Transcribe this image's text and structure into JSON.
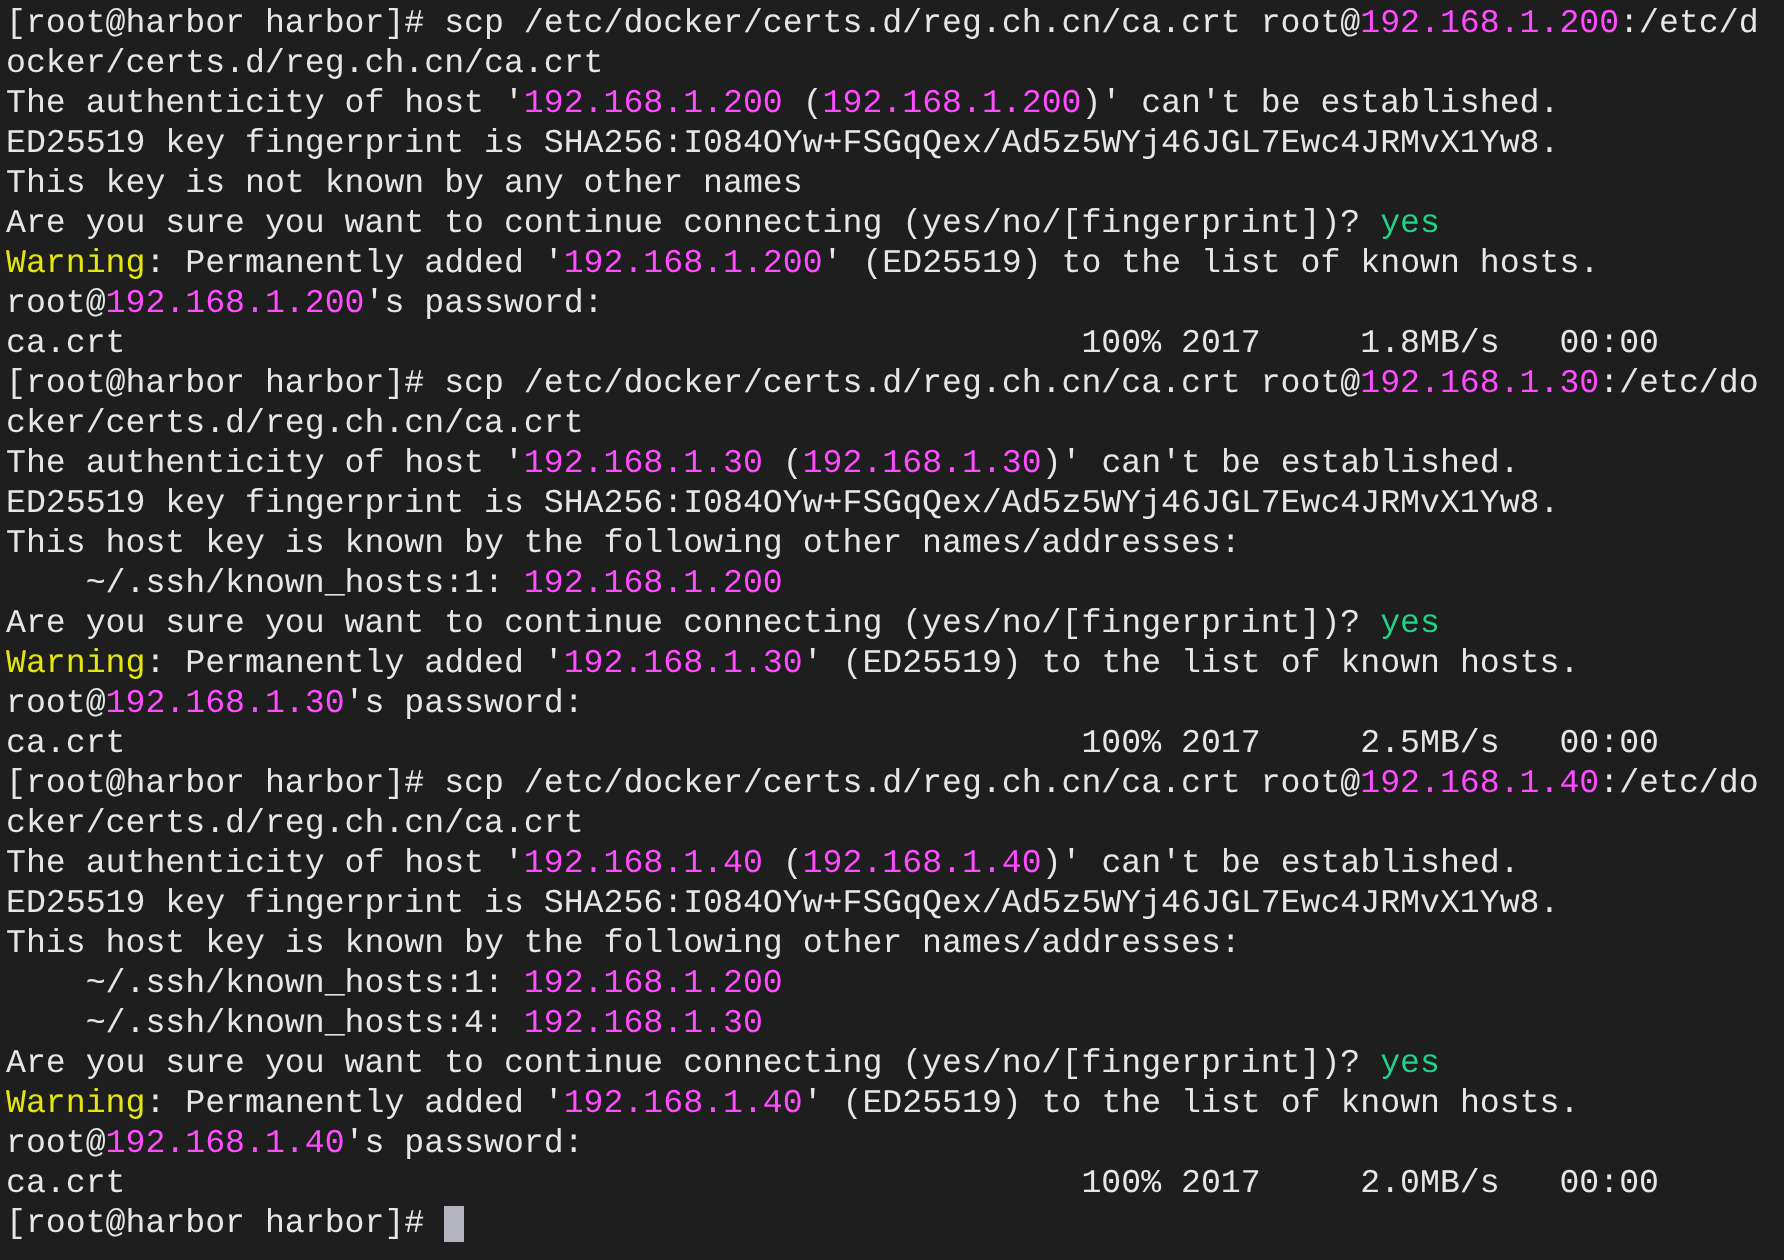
{
  "terminal": {
    "lines": [
      {
        "segments": [
          {
            "text": "[root@harbor harbor]# scp /etc/docker/certs.d/reg.ch.cn/ca.crt root@",
            "kind": "plain"
          },
          {
            "text": "192.168.1.200",
            "kind": "ip"
          },
          {
            "text": ":/etc/d",
            "kind": "plain"
          }
        ]
      },
      {
        "segments": [
          {
            "text": "ocker/certs.d/reg.ch.cn/ca.crt",
            "kind": "plain"
          }
        ]
      },
      {
        "segments": [
          {
            "text": "The authenticity of host '",
            "kind": "plain"
          },
          {
            "text": "192.168.1.200",
            "kind": "ip"
          },
          {
            "text": " (",
            "kind": "plain"
          },
          {
            "text": "192.168.1.200",
            "kind": "ip"
          },
          {
            "text": ")' can't be established.",
            "kind": "plain"
          }
        ]
      },
      {
        "segments": [
          {
            "text": "ED25519 key fingerprint is SHA256:I084OYw+FSGqQex/Ad5z5WYj46JGL7Ewc4JRMvX1Yw8.",
            "kind": "plain"
          }
        ]
      },
      {
        "segments": [
          {
            "text": "This key is not known by any other names",
            "kind": "plain"
          }
        ]
      },
      {
        "segments": [
          {
            "text": "Are you sure you want to continue connecting (yes/no/[fingerprint])? ",
            "kind": "plain"
          },
          {
            "text": "yes",
            "kind": "answer"
          }
        ]
      },
      {
        "segments": [
          {
            "text": "Warning",
            "kind": "warning"
          },
          {
            "text": ": Permanently added '",
            "kind": "plain"
          },
          {
            "text": "192.168.1.200",
            "kind": "ip"
          },
          {
            "text": "' (ED25519) to the list of known hosts.",
            "kind": "plain"
          }
        ]
      },
      {
        "segments": [
          {
            "text": "root@",
            "kind": "plain"
          },
          {
            "text": "192.168.1.200",
            "kind": "ip"
          },
          {
            "text": "'s password:",
            "kind": "plain"
          }
        ]
      },
      {
        "segments": [
          {
            "text": "ca.crt                                                100% 2017     1.8MB/s   00:00",
            "kind": "plain"
          }
        ]
      },
      {
        "segments": [
          {
            "text": "[root@harbor harbor]# scp /etc/docker/certs.d/reg.ch.cn/ca.crt root@",
            "kind": "plain"
          },
          {
            "text": "192.168.1.30",
            "kind": "ip"
          },
          {
            "text": ":/etc/do",
            "kind": "plain"
          }
        ]
      },
      {
        "segments": [
          {
            "text": "cker/certs.d/reg.ch.cn/ca.crt",
            "kind": "plain"
          }
        ]
      },
      {
        "segments": [
          {
            "text": "The authenticity of host '",
            "kind": "plain"
          },
          {
            "text": "192.168.1.30",
            "kind": "ip"
          },
          {
            "text": " (",
            "kind": "plain"
          },
          {
            "text": "192.168.1.30",
            "kind": "ip"
          },
          {
            "text": ")' can't be established.",
            "kind": "plain"
          }
        ]
      },
      {
        "segments": [
          {
            "text": "ED25519 key fingerprint is SHA256:I084OYw+FSGqQex/Ad5z5WYj46JGL7Ewc4JRMvX1Yw8.",
            "kind": "plain"
          }
        ]
      },
      {
        "segments": [
          {
            "text": "This host key is known by the following other names/addresses:",
            "kind": "plain"
          }
        ]
      },
      {
        "segments": [
          {
            "text": "    ~/.ssh/known_hosts:1: ",
            "kind": "plain"
          },
          {
            "text": "192.168.1.200",
            "kind": "ip"
          }
        ]
      },
      {
        "segments": [
          {
            "text": "Are you sure you want to continue connecting (yes/no/[fingerprint])? ",
            "kind": "plain"
          },
          {
            "text": "yes",
            "kind": "answer"
          }
        ]
      },
      {
        "segments": [
          {
            "text": "Warning",
            "kind": "warning"
          },
          {
            "text": ": Permanently added '",
            "kind": "plain"
          },
          {
            "text": "192.168.1.30",
            "kind": "ip"
          },
          {
            "text": "' (ED25519) to the list of known hosts.",
            "kind": "plain"
          }
        ]
      },
      {
        "segments": [
          {
            "text": "root@",
            "kind": "plain"
          },
          {
            "text": "192.168.1.30",
            "kind": "ip"
          },
          {
            "text": "'s password:",
            "kind": "plain"
          }
        ]
      },
      {
        "segments": [
          {
            "text": "ca.crt                                                100% 2017     2.5MB/s   00:00",
            "kind": "plain"
          }
        ]
      },
      {
        "segments": [
          {
            "text": "[root@harbor harbor]# scp /etc/docker/certs.d/reg.ch.cn/ca.crt root@",
            "kind": "plain"
          },
          {
            "text": "192.168.1.40",
            "kind": "ip"
          },
          {
            "text": ":/etc/do",
            "kind": "plain"
          }
        ]
      },
      {
        "segments": [
          {
            "text": "cker/certs.d/reg.ch.cn/ca.crt",
            "kind": "plain"
          }
        ]
      },
      {
        "segments": [
          {
            "text": "The authenticity of host '",
            "kind": "plain"
          },
          {
            "text": "192.168.1.40",
            "kind": "ip"
          },
          {
            "text": " (",
            "kind": "plain"
          },
          {
            "text": "192.168.1.40",
            "kind": "ip"
          },
          {
            "text": ")' can't be established.",
            "kind": "plain"
          }
        ]
      },
      {
        "segments": [
          {
            "text": "ED25519 key fingerprint is SHA256:I084OYw+FSGqQex/Ad5z5WYj46JGL7Ewc4JRMvX1Yw8.",
            "kind": "plain"
          }
        ]
      },
      {
        "segments": [
          {
            "text": "This host key is known by the following other names/addresses:",
            "kind": "plain"
          }
        ]
      },
      {
        "segments": [
          {
            "text": "    ~/.ssh/known_hosts:1: ",
            "kind": "plain"
          },
          {
            "text": "192.168.1.200",
            "kind": "ip"
          }
        ]
      },
      {
        "segments": [
          {
            "text": "    ~/.ssh/known_hosts:4: ",
            "kind": "plain"
          },
          {
            "text": "192.168.1.30",
            "kind": "ip"
          }
        ]
      },
      {
        "segments": [
          {
            "text": "Are you sure you want to continue connecting (yes/no/[fingerprint])? ",
            "kind": "plain"
          },
          {
            "text": "yes",
            "kind": "answer"
          }
        ]
      },
      {
        "segments": [
          {
            "text": "Warning",
            "kind": "warning"
          },
          {
            "text": ": Permanently added '",
            "kind": "plain"
          },
          {
            "text": "192.168.1.40",
            "kind": "ip"
          },
          {
            "text": "' (ED25519) to the list of known hosts.",
            "kind": "plain"
          }
        ]
      },
      {
        "segments": [
          {
            "text": "root@",
            "kind": "plain"
          },
          {
            "text": "192.168.1.40",
            "kind": "ip"
          },
          {
            "text": "'s password:",
            "kind": "plain"
          }
        ]
      },
      {
        "segments": [
          {
            "text": "ca.crt                                                100% 2017     2.0MB/s   00:00",
            "kind": "plain"
          }
        ]
      },
      {
        "segments": [
          {
            "text": "[root@harbor harbor]# ",
            "kind": "plain"
          }
        ],
        "cursor": true
      }
    ]
  }
}
